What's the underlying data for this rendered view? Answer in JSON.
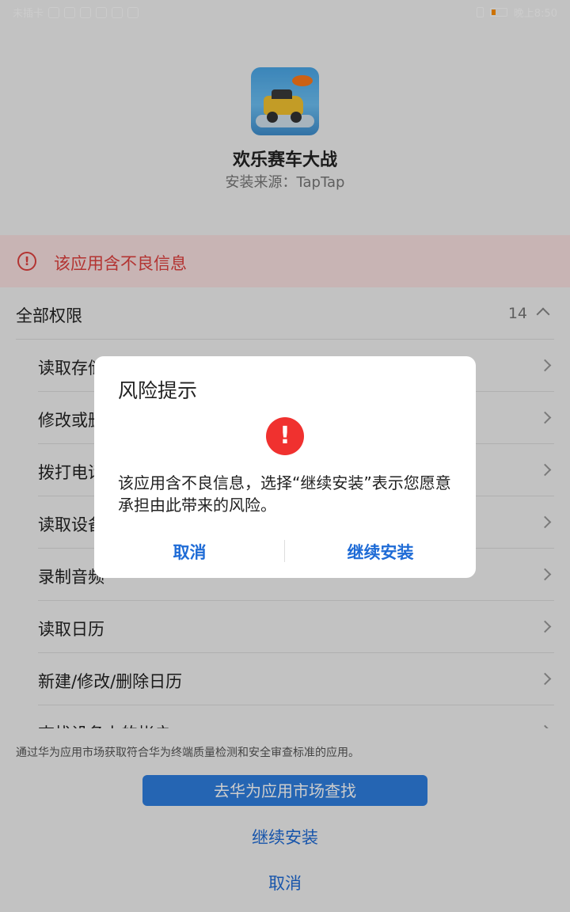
{
  "status_bar": {
    "carrier": "未插卡",
    "time": "晚上8:50"
  },
  "app": {
    "name": "欢乐赛车大战",
    "source": "安装来源：TapTap"
  },
  "warning": {
    "text": "该应用含不良信息",
    "color": "#e0413f"
  },
  "permissions": {
    "title": "全部权限",
    "count": "14",
    "items": [
      {
        "label": "读取存储卡中的内容"
      },
      {
        "label": "修改或删除存储卡中的内容"
      },
      {
        "label": "拨打电话"
      },
      {
        "label": "读取设备信息"
      },
      {
        "label": "录制音频"
      },
      {
        "label": "读取日历"
      },
      {
        "label": "新建/修改/删除日历"
      },
      {
        "label": "查找设备上的帐户"
      }
    ]
  },
  "footer": {
    "note": "通过华为应用市场获取符合华为终端质量检测和安全审查标准的应用。",
    "market_button": "去华为应用市场查找",
    "continue": "继续安装",
    "cancel": "取消"
  },
  "dialog": {
    "title": "风险提示",
    "message": "该应用含不良信息，选择“继续安装”表示您愿意承担由此带来的风险。",
    "cancel": "取消",
    "confirm": "继续安装",
    "alert_color": "#f0312f",
    "accent": "#1e6bd6"
  }
}
